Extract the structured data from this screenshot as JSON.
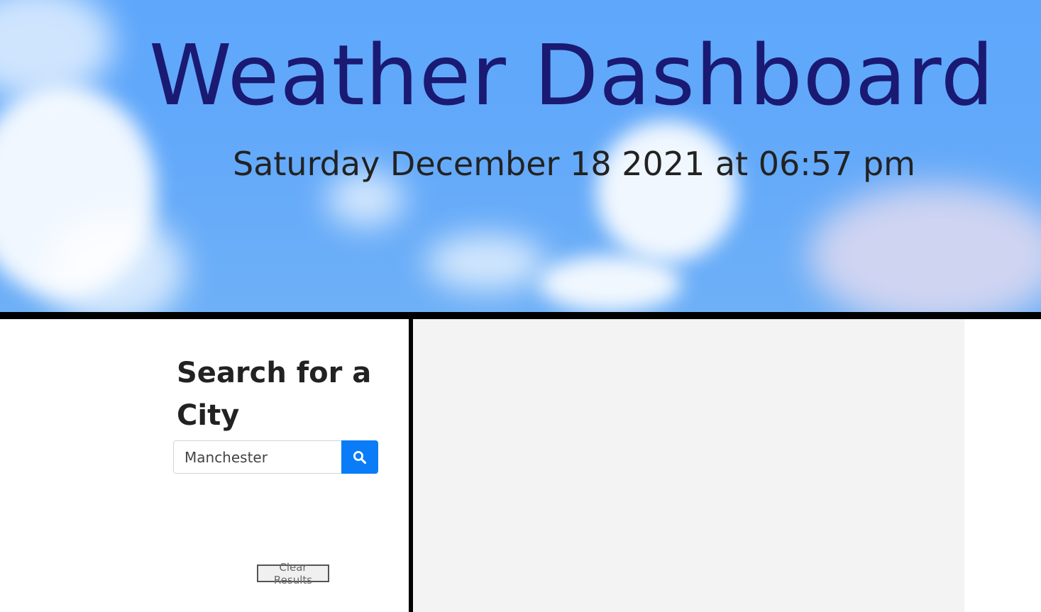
{
  "header": {
    "title": "Weather Dashboard",
    "datetime": "Saturday December 18 2021 at 06:57 pm"
  },
  "search": {
    "heading": "Search for a City",
    "input_value": "Manchester",
    "button_icon": "search-icon",
    "clear_label": "Clear Results"
  },
  "colors": {
    "title": "#1a1a73",
    "sky": "#5ea7fb",
    "search_button": "#0a7cf7",
    "results_background": "#f3f3f3",
    "divider": "#000000"
  }
}
